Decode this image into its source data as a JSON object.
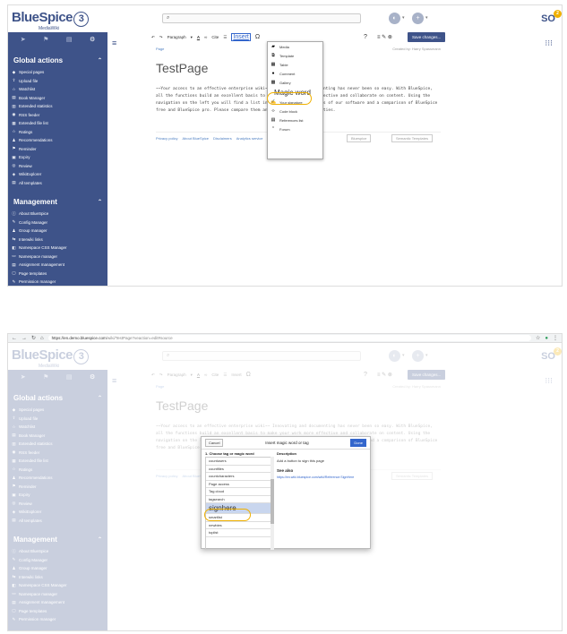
{
  "app": {
    "logo_main": "BlueSpice",
    "logo_num": "3",
    "logo_sub": "MediaWiki",
    "user_initials": "SO",
    "notify_count": "2"
  },
  "browser": {
    "url_host": "https://en.demo.bluespice.com",
    "url_path": "/wiki/TestPage?veaction=edit#source"
  },
  "sidebar": {
    "global_title": "Global actions",
    "global_items": [
      "Special pages",
      "Upload file",
      "Watchlist",
      "Book Manager",
      "Extended statistics",
      "RSS feeder",
      "Extended file list",
      "Ratings",
      "Recommendations",
      "Reminder",
      "Expiry",
      "Review",
      "WikiExplorer",
      "All templates"
    ],
    "management_title": "Management",
    "management_items": [
      "About BlueSpice",
      "Config Manager",
      "Group manager",
      "Interwiki links",
      "Namespace CSS Manager",
      "Namespace manager",
      "Assignment management",
      "Page templates",
      "Permission manager"
    ]
  },
  "toolbar": {
    "format": "Paragraph",
    "cite": "Cite",
    "insert": "Insert",
    "omega": "Ω",
    "help": "?",
    "save": "Save changes..."
  },
  "page": {
    "breadcrumb": "Page",
    "meta": "Created by: Harry Spassmann",
    "title": "TestPage",
    "body_prefix": "~~Your access to an effective enterprise wiki~~ ",
    "body_rest": "Innovating and documenting has never been so easy. With BlueSpice, all the functions build an excellent basis to make your work more effective and collaborate on content. Using the navigation on the left you will find a list including all the features of our software and a comparison of BlueSpice free and BlueSpice pro. Please compare them and see all the possibilities."
  },
  "footer": {
    "links": [
      "Privacy policy",
      "About BlueSpice",
      "Disclaimers",
      "Analytics service"
    ],
    "btn_bluespice": "Bluespice",
    "btn_semantic": "Semantic Templates"
  },
  "insert_menu": {
    "items": [
      "Media",
      "Template",
      "Table",
      "Comment",
      "Gallery",
      "Magic word",
      "Your signature",
      "Code block",
      "References list",
      "Forum"
    ],
    "icons": [
      "media-icon",
      "template-icon",
      "table-icon",
      "comment-icon",
      "gallery-icon",
      "magic-icon",
      "signature-icon",
      "code-icon",
      "references-icon",
      "forum-icon"
    ]
  },
  "dialog": {
    "cancel": "Cancel",
    "title": "Insert magic word or tag",
    "done": "Done",
    "choose_label": "1. Choose tag or magic word",
    "options": [
      "countusers",
      "countfiles",
      "countcharacters",
      "Page access",
      "Tag cloud",
      "tagsearch",
      "signhere",
      "smartlist",
      "newbies",
      "toplist"
    ],
    "selected": "signhere",
    "description_label": "Description",
    "description_text": "Add a button to sign this page",
    "see_also": "See also",
    "see_also_link": "https://en.wiki.bluespice.com/wiki/Reference:SignHere"
  },
  "colors": {
    "brand": "#3e5389",
    "highlight": "#f0b100",
    "done": "#3366cc"
  }
}
